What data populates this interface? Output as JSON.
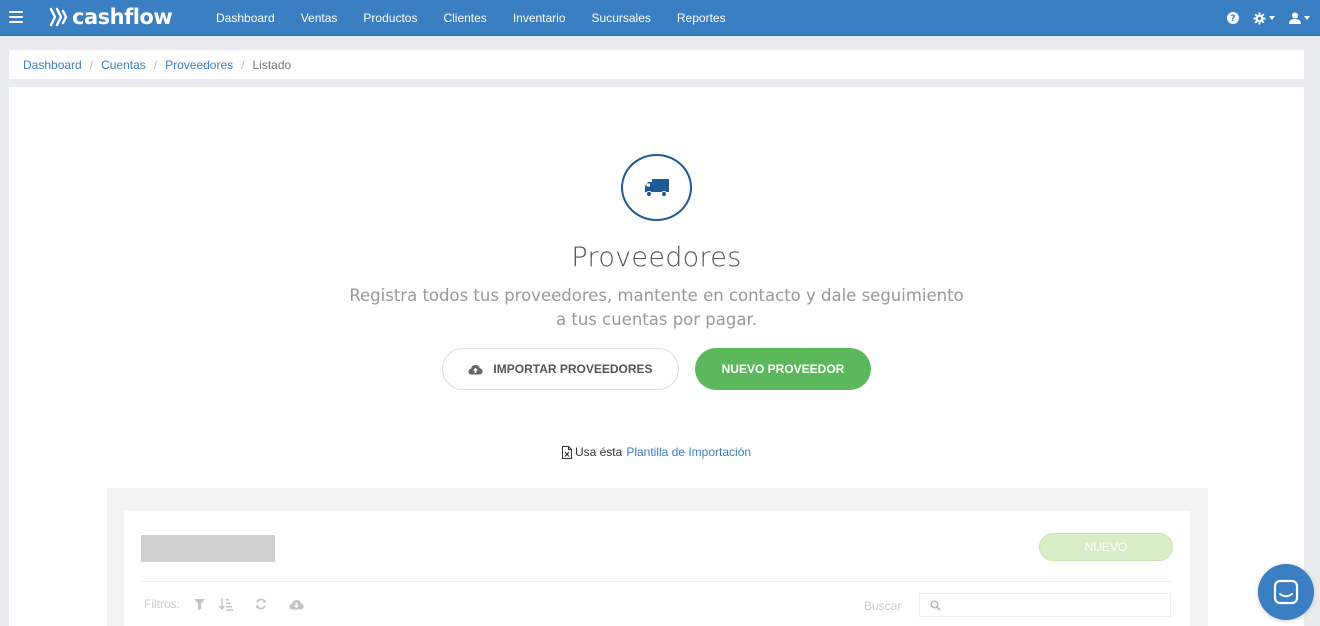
{
  "app": {
    "brand": "cashflow",
    "colors": {
      "primary": "#3a7fc1",
      "success": "#5cb85c",
      "dark_blue": "#1f5a96"
    }
  },
  "nav": {
    "items": [
      {
        "label": "Dashboard"
      },
      {
        "label": "Ventas"
      },
      {
        "label": "Productos"
      },
      {
        "label": "Clientes"
      },
      {
        "label": "Inventario"
      },
      {
        "label": "Sucursales"
      },
      {
        "label": "Reportes"
      }
    ],
    "right_icons": [
      "help-icon",
      "gear-icon",
      "user-icon"
    ]
  },
  "breadcrumb": {
    "items": [
      "Dashboard",
      "Cuentas",
      "Proveedores"
    ],
    "current": "Listado",
    "separator": "/"
  },
  "hero": {
    "icon": "truck-icon",
    "title": "Proveedores",
    "subtitle": "Registra todos tus proveedores, mantente en contacto y dale seguimiento a tus cuentas por pagar.",
    "import_button": "IMPORTAR PROVEEDORES",
    "new_button": "NUEVO PROVEEDOR"
  },
  "template_note": {
    "prefix": "Usa ésta",
    "link": "Plantilla de Importación"
  },
  "preview": {
    "new_label": "NUEVO",
    "filters_label": "Filtros:",
    "search_label": "Buscar"
  }
}
